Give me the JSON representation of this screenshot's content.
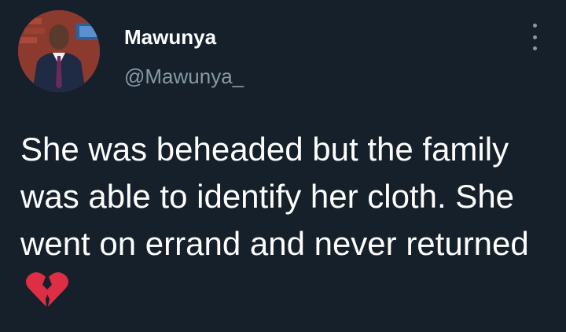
{
  "tweet": {
    "author_name": "Mawunya",
    "author_handle": "@Mawunya_",
    "text": "She was beheaded but the family was able to identify her cloth. She went on errand and never returned",
    "emoji": "broken-heart-icon"
  },
  "colors": {
    "background": "#15202b",
    "text_primary": "#ffffff",
    "text_secondary": "#8899a6",
    "emoji_red": "#dd2e44"
  }
}
